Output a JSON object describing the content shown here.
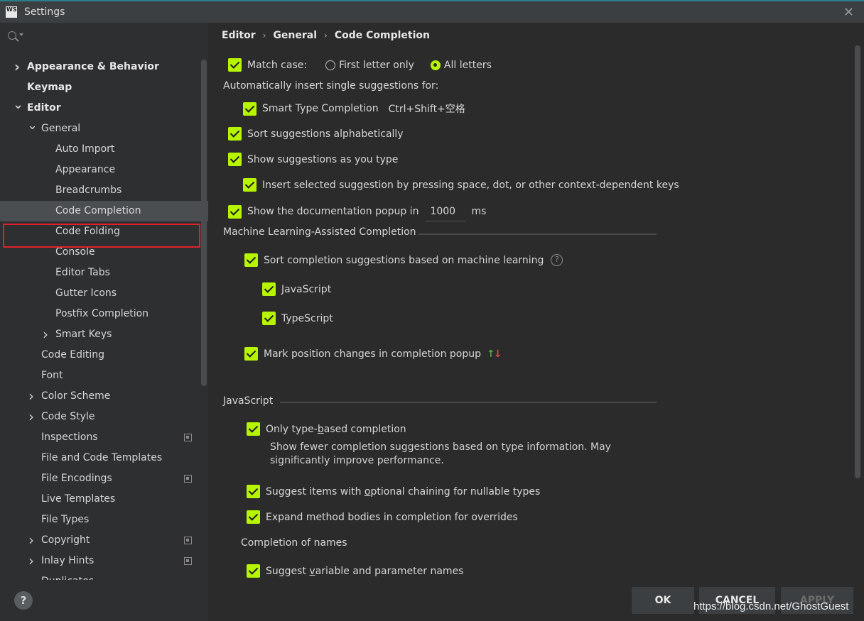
{
  "window": {
    "title": "Settings",
    "logo_text": "WS"
  },
  "sidebar": {
    "items": [
      {
        "label": "Appearance & Behavior",
        "level": 0,
        "bold": true,
        "arrow": "right",
        "copy": false
      },
      {
        "label": "Keymap",
        "level": 0,
        "bold": true,
        "arrow": "none",
        "copy": false
      },
      {
        "label": "Editor",
        "level": 0,
        "bold": true,
        "arrow": "down",
        "copy": false
      },
      {
        "label": "General",
        "level": 1,
        "bold": false,
        "arrow": "down",
        "copy": false
      },
      {
        "label": "Auto Import",
        "level": 2,
        "bold": false,
        "arrow": "none",
        "copy": false
      },
      {
        "label": "Appearance",
        "level": 2,
        "bold": false,
        "arrow": "none",
        "copy": false
      },
      {
        "label": "Breadcrumbs",
        "level": 2,
        "bold": false,
        "arrow": "none",
        "copy": false
      },
      {
        "label": "Code Completion",
        "level": 2,
        "bold": false,
        "arrow": "none",
        "copy": false,
        "selected": true
      },
      {
        "label": "Code Folding",
        "level": 2,
        "bold": false,
        "arrow": "none",
        "copy": false
      },
      {
        "label": "Console",
        "level": 2,
        "bold": false,
        "arrow": "none",
        "copy": false
      },
      {
        "label": "Editor Tabs",
        "level": 2,
        "bold": false,
        "arrow": "none",
        "copy": false
      },
      {
        "label": "Gutter Icons",
        "level": 2,
        "bold": false,
        "arrow": "none",
        "copy": false
      },
      {
        "label": "Postfix Completion",
        "level": 2,
        "bold": false,
        "arrow": "none",
        "copy": false
      },
      {
        "label": "Smart Keys",
        "level": 2,
        "bold": false,
        "arrow": "right",
        "copy": false
      },
      {
        "label": "Code Editing",
        "level": 1,
        "bold": false,
        "arrow": "none",
        "copy": false
      },
      {
        "label": "Font",
        "level": 1,
        "bold": false,
        "arrow": "none",
        "copy": false
      },
      {
        "label": "Color Scheme",
        "level": 1,
        "bold": false,
        "arrow": "right",
        "copy": false
      },
      {
        "label": "Code Style",
        "level": 1,
        "bold": false,
        "arrow": "right",
        "copy": false
      },
      {
        "label": "Inspections",
        "level": 1,
        "bold": false,
        "arrow": "none",
        "copy": true
      },
      {
        "label": "File and Code Templates",
        "level": 1,
        "bold": false,
        "arrow": "none",
        "copy": false
      },
      {
        "label": "File Encodings",
        "level": 1,
        "bold": false,
        "arrow": "none",
        "copy": true
      },
      {
        "label": "Live Templates",
        "level": 1,
        "bold": false,
        "arrow": "none",
        "copy": false
      },
      {
        "label": "File Types",
        "level": 1,
        "bold": false,
        "arrow": "none",
        "copy": false
      },
      {
        "label": "Copyright",
        "level": 1,
        "bold": false,
        "arrow": "right",
        "copy": true
      },
      {
        "label": "Inlay Hints",
        "level": 1,
        "bold": false,
        "arrow": "right",
        "copy": true
      },
      {
        "label": "Duplicates",
        "level": 1,
        "bold": false,
        "arrow": "none",
        "copy": false
      }
    ],
    "help_label": "?"
  },
  "breadcrumb": {
    "items": [
      "Editor",
      "General",
      "Code Completion"
    ]
  },
  "settings": {
    "match_case": {
      "label": "Match case:",
      "checked": true,
      "options": [
        "First letter only",
        "All letters"
      ],
      "selected": "All letters"
    },
    "auto_insert_heading": "Automatically insert single suggestions for:",
    "smart_type": {
      "label": "Smart Type Completion",
      "shortcut": "Ctrl+Shift+空格"
    },
    "sort_alpha": "Sort suggestions alphabetically",
    "show_as_type": "Show suggestions as you type",
    "insert_selected": "Insert selected suggestion by pressing space, dot, or other context-dependent keys",
    "doc_popup": {
      "label": "Show the documentation popup in",
      "value": "1000",
      "unit": "ms"
    },
    "ml_heading": "Machine Learning-Assisted Completion",
    "ml_sort": "Sort completion suggestions based on machine learning",
    "ml_js": "JavaScript",
    "ml_ts": "TypeScript",
    "mark_position": "Mark position changes in completion popup",
    "js_heading": "JavaScript",
    "type_based": {
      "pre": "Only type-",
      "u": "b",
      "post": "ased completion"
    },
    "type_based_desc": "Show fewer completion suggestions based on type information. May significantly improve performance.",
    "optional_chain": {
      "pre": "Suggest items with ",
      "u": "o",
      "post": "ptional chaining for nullable types"
    },
    "expand_method": "Expand method bodies in completion for overrides",
    "names_heading": "Completion of names",
    "var_names": {
      "pre": "Suggest ",
      "u": "v",
      "post": "ariable and parameter names"
    }
  },
  "buttons": {
    "ok": "OK",
    "cancel": "CANCEL",
    "apply": "APPLY"
  },
  "watermark": "https://blog.csdn.net/GhostGuest",
  "colors": {
    "accent": "#b7f400",
    "selection_outline": "#e0212a",
    "background": "#2b2b2b",
    "sidebar": "#2d2f31"
  }
}
